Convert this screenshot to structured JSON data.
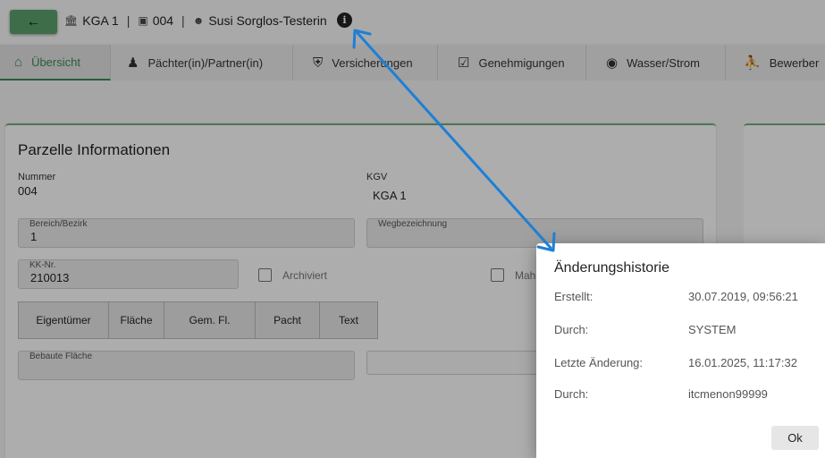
{
  "header": {
    "back_icon": "arrow-left-icon",
    "crumb_kga": "KGA 1",
    "crumb_parcel": "004",
    "crumb_person": "Susi Sorglos-Testerin",
    "separator": "|",
    "info_glyph": "i"
  },
  "tabs": [
    {
      "label": "Übersicht",
      "icon": "home-icon"
    },
    {
      "label": "Pächter(in)/Partner(in)",
      "icon": "people-icon"
    },
    {
      "label": "Versicherungen",
      "icon": "shield-icon"
    },
    {
      "label": "Genehmigungen",
      "icon": "checklist-icon"
    },
    {
      "label": "Wasser/Strom",
      "icon": "tap-icon"
    },
    {
      "label": "Bewerber",
      "icon": "person-walking-icon"
    }
  ],
  "card": {
    "title": "Parzelle Informationen",
    "nummer_label": "Nummer",
    "nummer_value": "004",
    "kgv_label": "KGV",
    "kgv_value": "KGA 1",
    "bereich_label": "Bereich/Bezirk",
    "bereich_value": "1",
    "weg_label": "Wegbezeichnung",
    "weg_value": "",
    "kk_label": "KK-Nr.",
    "kk_value": "210013",
    "archiviert_label": "Archiviert",
    "mahn_label": "Mah",
    "buttons": [
      "Eigentümer",
      "Fläche",
      "Gem. Fl.",
      "Pacht",
      "Text"
    ],
    "bebaute_label": "Bebaute Fläche"
  },
  "dialog": {
    "title": "Änderungshistorie",
    "rows": [
      {
        "label": "Erstellt:",
        "value": "30.07.2019, 09:56:21"
      },
      {
        "label": "Durch:",
        "value": "SYSTEM"
      },
      {
        "label": "Letzte Änderung:",
        "value": "16.01.2025, 11:17:32"
      },
      {
        "label": "Durch:",
        "value": "itcmenon99999"
      }
    ],
    "ok_label": "Ok"
  },
  "colors": {
    "accent_green": "#3b8b56",
    "arrow_blue": "#1e7fd6"
  }
}
